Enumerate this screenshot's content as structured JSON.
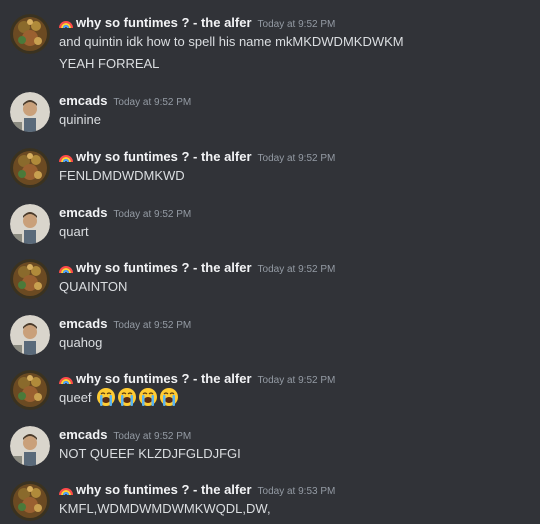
{
  "users": {
    "alfer": {
      "name": "why so funtimes ? - the alfer",
      "name_prefix_icon": "rainbow-icon",
      "avatar": "alfer-avatar-image"
    },
    "emcads": {
      "name": "emcads",
      "avatar": "emcads-avatar-image"
    }
  },
  "messages": [
    {
      "author": "why so funtimes ? - the alfer",
      "timestamp": "Today at 9:52 PM",
      "lines": [
        "and quintin idk how to spell his name mkMKDWDMKDWKM",
        "YEAH FORREAL"
      ]
    },
    {
      "author": "emcads",
      "timestamp": "Today at 9:52 PM",
      "lines": [
        "quinine"
      ]
    },
    {
      "author": "why so funtimes ? - the alfer",
      "timestamp": "Today at 9:52 PM",
      "lines": [
        "FENLDMDWDMKWD"
      ]
    },
    {
      "author": "emcads",
      "timestamp": "Today at 9:52 PM",
      "lines": [
        "quart"
      ]
    },
    {
      "author": "why so funtimes ? - the alfer",
      "timestamp": "Today at 9:52 PM",
      "lines": [
        "QUAINTON"
      ]
    },
    {
      "author": "emcads",
      "timestamp": "Today at 9:52 PM",
      "lines": [
        "quahog"
      ]
    },
    {
      "author": "why so funtimes ? - the alfer",
      "timestamp": "Today at 9:52 PM",
      "lines": [
        "queef"
      ],
      "emojis": [
        "loudly-crying-face-emoji",
        "loudly-crying-face-emoji",
        "loudly-crying-face-emoji",
        "loudly-crying-face-emoji"
      ]
    },
    {
      "author": "emcads",
      "timestamp": "Today at 9:52 PM",
      "lines": [
        "NOT QUEEF KLZDJFGLDJFGI"
      ]
    },
    {
      "author": "why so funtimes ? - the alfer",
      "timestamp": "Today at 9:53 PM",
      "lines": [
        "KMFL,WDMDWMDWMKWQDL,DW,"
      ]
    }
  ],
  "colors": {
    "background": "#313338",
    "author_name": "#f2f3f5",
    "message_text": "#dbdee1",
    "timestamp": "#949ba4"
  }
}
